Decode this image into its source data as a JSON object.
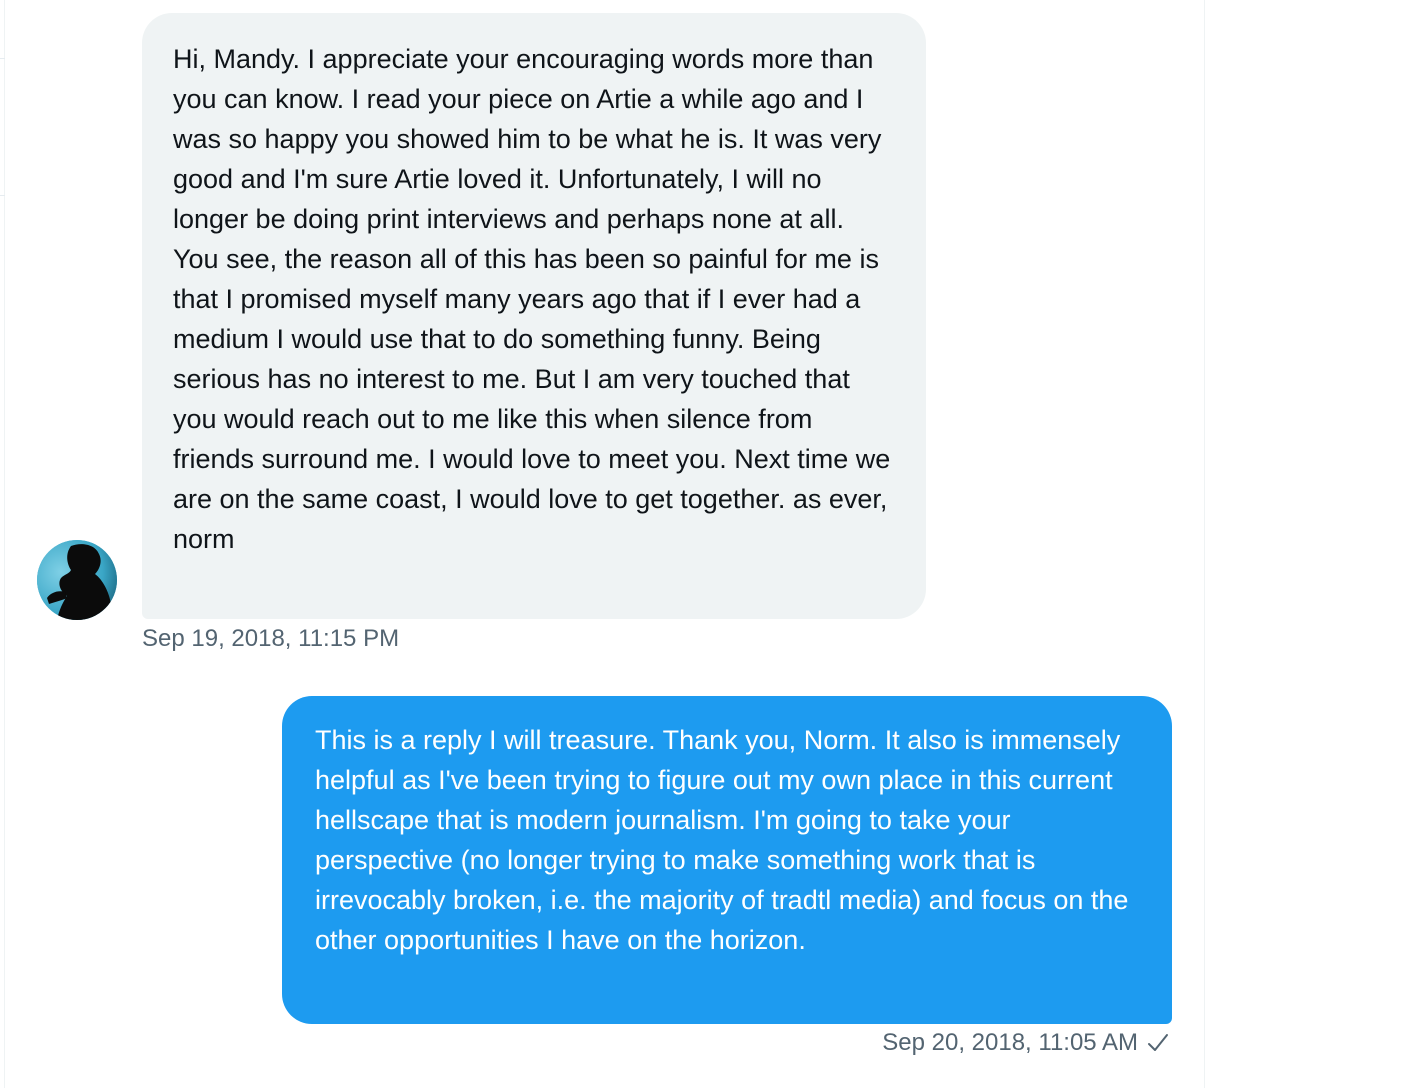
{
  "conversation": {
    "messages": [
      {
        "direction": "received",
        "text": "Hi, Mandy. I appreciate your encouraging words more than you can know. I read your piece on Artie a while ago and I was so happy you showed him to be what he is. It was very good and I'm sure Artie loved it. Unfortunately, I will no longer be doing print interviews and perhaps none at all. You see, the reason all of this has been so painful for me is that I promised myself many years ago that if I ever had a medium I would use that to do something funny. Being serious has no interest to me. But I am very touched that you would reach out to me like this when silence from friends surround me. I would love to meet you. Next time we are on the same coast, I would love to get together. as ever, norm",
        "timestamp": "Sep 19, 2018, 11:15 PM"
      },
      {
        "direction": "sent",
        "text": "This is a reply I will treasure. Thank you, Norm. It also is immensely helpful as I've been trying to figure out my own place in this current hellscape that is modern journalism. I'm going to take your perspective (no longer trying to make something work that is irrevocably broken, i.e. the majority of tradtl media) and focus on the other opportunities I have on the horizon.",
        "timestamp": "Sep 20, 2018, 11:05 AM",
        "status_icon": "check-icon"
      }
    ]
  },
  "colors": {
    "received_bubble": "#eff3f4",
    "sent_bubble": "#1d9bf0",
    "timestamp": "#536471",
    "text_dark": "#0f1419"
  }
}
